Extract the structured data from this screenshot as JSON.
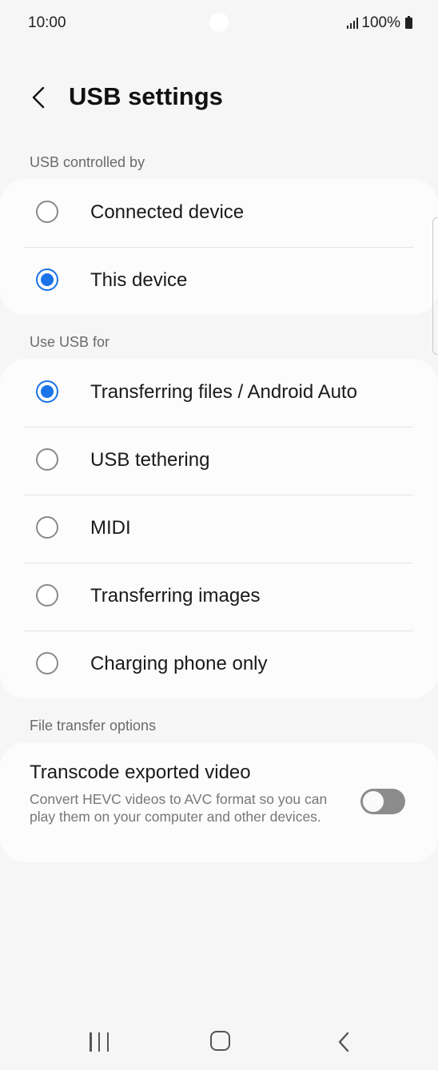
{
  "status": {
    "time": "10:00",
    "battery": "100%"
  },
  "header": {
    "title": "USB settings"
  },
  "usb_controlled_by": {
    "label": "USB controlled by",
    "options": [
      {
        "label": "Connected device",
        "selected": false
      },
      {
        "label": "This device",
        "selected": true
      }
    ]
  },
  "use_usb_for": {
    "label": "Use USB for",
    "options": [
      {
        "label": "Transferring files / Android Auto",
        "selected": true
      },
      {
        "label": "USB tethering",
        "selected": false
      },
      {
        "label": "MIDI",
        "selected": false
      },
      {
        "label": "Transferring images",
        "selected": false
      },
      {
        "label": "Charging phone only",
        "selected": false
      }
    ]
  },
  "file_transfer": {
    "label": "File transfer options",
    "transcode_title": "Transcode exported video",
    "transcode_desc": "Convert HEVC videos to AVC format so you can play them on your computer and other devices.",
    "transcode_enabled": false
  },
  "colors": {
    "accent": "#1a73e8",
    "background": "#f6f6f6",
    "card": "#fcfcfc"
  }
}
